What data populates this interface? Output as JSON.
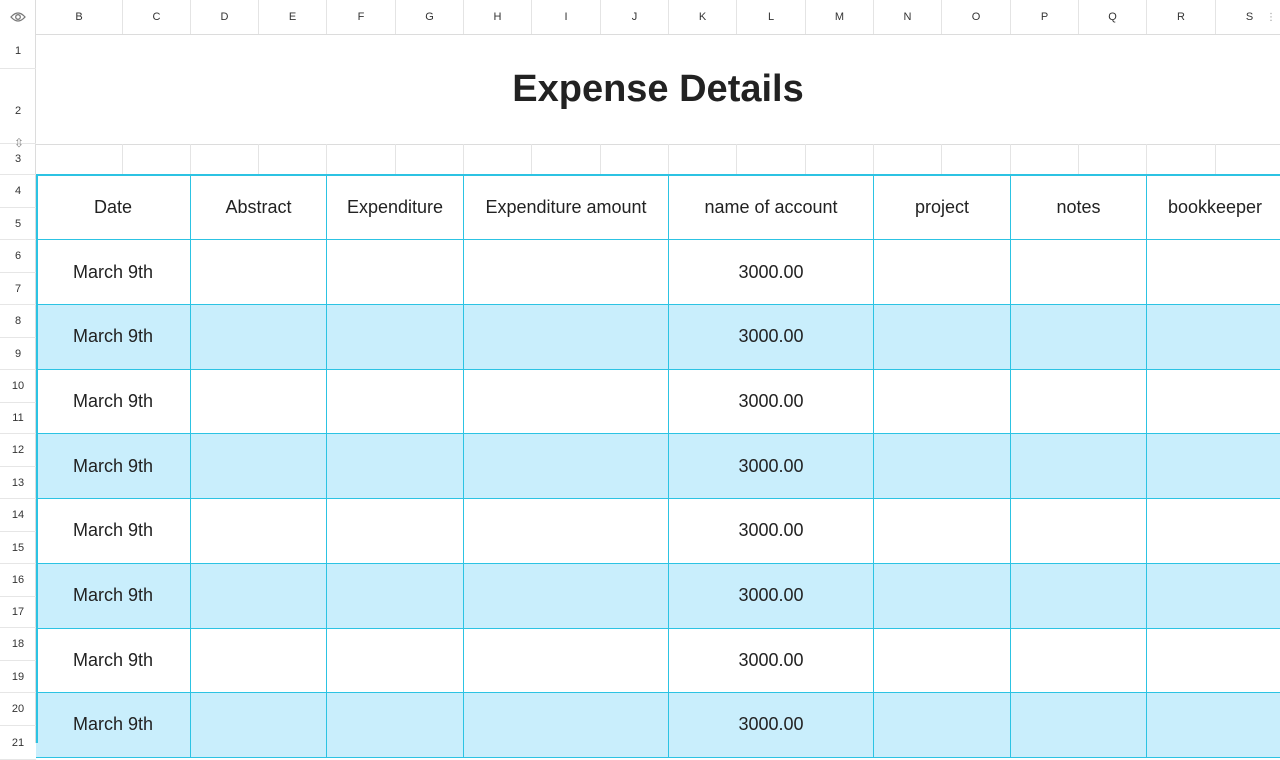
{
  "sheet": {
    "title": "Expense Details",
    "column_letters": [
      "B",
      "C",
      "D",
      "E",
      "F",
      "G",
      "H",
      "I",
      "J",
      "K",
      "L",
      "M",
      "N",
      "O",
      "P",
      "Q",
      "R",
      "S"
    ],
    "row_numbers": [
      "1",
      "2",
      "3",
      "4",
      "5",
      "6",
      "7",
      "8",
      "9",
      "10",
      "11",
      "12",
      "13",
      "14",
      "15",
      "16",
      "17",
      "18",
      "19",
      "20",
      "21"
    ],
    "colors": {
      "border": "#2cc3e3",
      "shaded_row": "#c9eefc"
    }
  },
  "table": {
    "headers": [
      "Date",
      "Abstract",
      "Expenditure",
      "Expenditure amount",
      "name of account",
      "project",
      "notes",
      "bookkeeper"
    ],
    "rows": [
      [
        "March 9th",
        "",
        "",
        "",
        "3000.00",
        "",
        "",
        ""
      ],
      [
        "March 9th",
        "",
        "",
        "",
        "3000.00",
        "",
        "",
        ""
      ],
      [
        "March 9th",
        "",
        "",
        "",
        "3000.00",
        "",
        "",
        ""
      ],
      [
        "March 9th",
        "",
        "",
        "",
        "3000.00",
        "",
        "",
        ""
      ],
      [
        "March 9th",
        "",
        "",
        "",
        "3000.00",
        "",
        "",
        ""
      ],
      [
        "March 9th",
        "",
        "",
        "",
        "3000.00",
        "",
        "",
        ""
      ],
      [
        "March 9th",
        "",
        "",
        "",
        "3000.00",
        "",
        "",
        ""
      ],
      [
        "March 9th",
        "",
        "",
        "",
        "3000.00",
        "",
        "",
        ""
      ]
    ]
  }
}
